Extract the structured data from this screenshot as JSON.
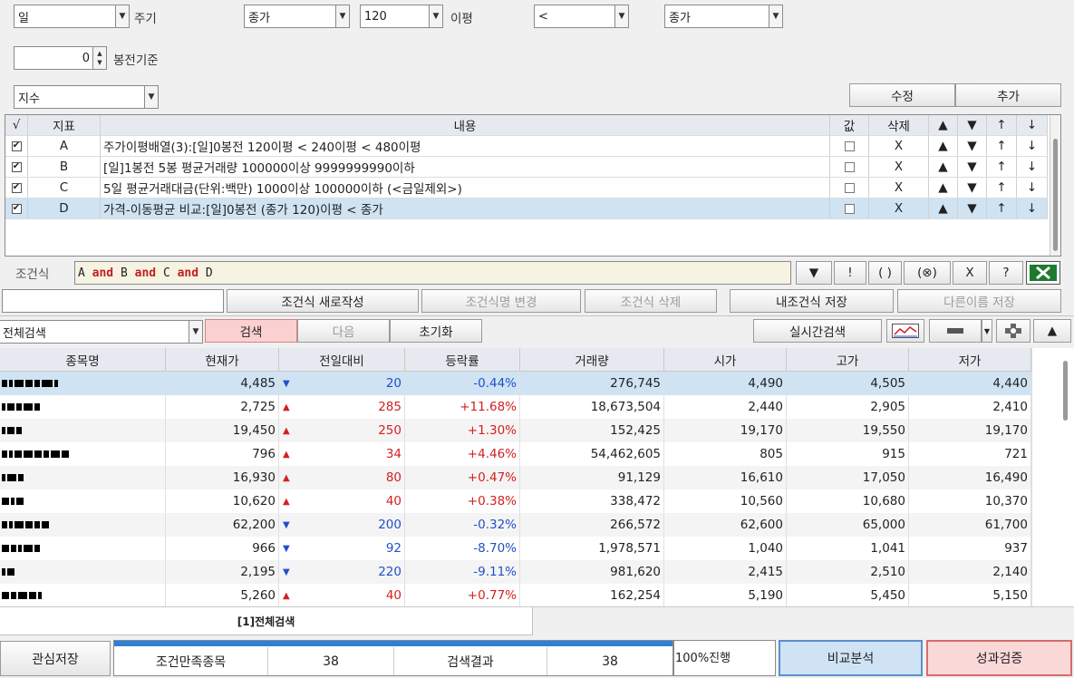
{
  "top": {
    "period_value": "일",
    "period_label": "주기",
    "price_type": "종가",
    "ma_period": "120",
    "ma_label": "이평",
    "operator": "<",
    "compare_type": "종가",
    "bong_value": "0",
    "bong_label": "봉전기준",
    "index_type": "지수",
    "edit_button": "수정",
    "add_button": "추가"
  },
  "condition_table": {
    "headers": [
      "√",
      "지표",
      "내용",
      "값",
      "삭제",
      "▲",
      "▼",
      "↑",
      "↓"
    ],
    "rows": [
      {
        "id": "A",
        "content": "주가이평배열(3):[일]0봉전 120이평 < 240이평 < 480이평",
        "delete": "X",
        "up": "▲",
        "down": "▼",
        "move_up": "↑",
        "move_down": "↓"
      },
      {
        "id": "B",
        "content": "[일]1봉전 5봉 평균거래량 100000이상 9999999990이하",
        "delete": "X",
        "up": "▲",
        "down": "▼",
        "move_up": "↑",
        "move_down": "↓"
      },
      {
        "id": "C",
        "content": "5일 평균거래대금(단위:백만) 1000이상 100000이하 (<금일제외>)",
        "delete": "X",
        "up": "▲",
        "down": "▼",
        "move_up": "↑",
        "move_down": "↓"
      },
      {
        "id": "D",
        "content": "가격-이동평균 비교:[일]0봉전 (종가 120)이평 < 종가",
        "delete": "X",
        "up": "▲",
        "down": "▼",
        "move_up": "↑",
        "move_down": "↓"
      }
    ]
  },
  "formula": {
    "label": "조건식",
    "tokens": [
      {
        "text": "A",
        "kind": "id"
      },
      {
        "text": " and ",
        "kind": "op"
      },
      {
        "text": "B",
        "kind": "id"
      },
      {
        "text": " and ",
        "kind": "op"
      },
      {
        "text": "C",
        "kind": "id"
      },
      {
        "text": " and ",
        "kind": "op"
      },
      {
        "text": "D",
        "kind": "id"
      }
    ],
    "tool_buttons": [
      "▼",
      "!",
      "( )",
      "(⊗)",
      "X",
      "?"
    ]
  },
  "actions": {
    "new": "조건식 새로작성",
    "rename": "조건식명 변경",
    "delete": "조건식 삭제",
    "save": "내조건식 저장",
    "save_as": "다른이름 저장"
  },
  "search_bar": {
    "scope": "전체검색",
    "search": "검색",
    "next": "다음",
    "reset": "초기화",
    "realtime": "실시간검색",
    "collapse": "▲"
  },
  "results": {
    "headers": [
      "종목명",
      "현재가",
      "전일대비",
      "등락률",
      "거래량",
      "시가",
      "고가",
      "저가"
    ],
    "rows": [
      {
        "price": "4,485",
        "dir": "down",
        "change": "20",
        "rate": "-0.44%",
        "volume": "276,745",
        "open": "4,490",
        "high": "4,505",
        "low": "4,440"
      },
      {
        "price": "2,725",
        "dir": "up",
        "change": "285",
        "rate": "+11.68%",
        "volume": "18,673,504",
        "open": "2,440",
        "high": "2,905",
        "low": "2,410"
      },
      {
        "price": "19,450",
        "dir": "up",
        "change": "250",
        "rate": "+1.30%",
        "volume": "152,425",
        "open": "19,170",
        "high": "19,550",
        "low": "19,170"
      },
      {
        "price": "796",
        "dir": "up",
        "change": "34",
        "rate": "+4.46%",
        "volume": "54,462,605",
        "open": "805",
        "high": "915",
        "low": "721"
      },
      {
        "price": "16,930",
        "dir": "up",
        "change": "80",
        "rate": "+0.47%",
        "volume": "91,129",
        "open": "16,610",
        "high": "17,050",
        "low": "16,490"
      },
      {
        "price": "10,620",
        "dir": "up",
        "change": "40",
        "rate": "+0.38%",
        "volume": "338,472",
        "open": "10,560",
        "high": "10,680",
        "low": "10,370"
      },
      {
        "price": "62,200",
        "dir": "down",
        "change": "200",
        "rate": "-0.32%",
        "volume": "266,572",
        "open": "62,600",
        "high": "65,000",
        "low": "61,700"
      },
      {
        "price": "966",
        "dir": "down",
        "change": "92",
        "rate": "-8.70%",
        "volume": "1,978,571",
        "open": "1,040",
        "high": "1,041",
        "low": "937"
      },
      {
        "price": "2,195",
        "dir": "down",
        "change": "220",
        "rate": "-9.11%",
        "volume": "981,620",
        "open": "2,415",
        "high": "2,510",
        "low": "2,140"
      },
      {
        "price": "5,260",
        "dir": "up",
        "change": "40",
        "rate": "+0.77%",
        "volume": "162,254",
        "open": "5,190",
        "high": "5,450",
        "low": "5,150"
      }
    ]
  },
  "bottom": {
    "tab": "[1]전체검색",
    "watch_save": "관심저장",
    "satisfied_label": "조건만족종목",
    "satisfied_count": "38",
    "result_label": "검색결과",
    "result_count": "38",
    "progress_text": "100%진행",
    "progress_fraction": 1.0,
    "compare": "비교분석",
    "verify": "성과검증"
  },
  "colors": {
    "up": "#d42020",
    "down": "#2050c8",
    "selected_row": "#cfe3f3",
    "search_button": "#fbd0d0",
    "compare_button": "#cfe3f5",
    "verify_button": "#fbd8d8",
    "progress": "#2f7fd8"
  }
}
